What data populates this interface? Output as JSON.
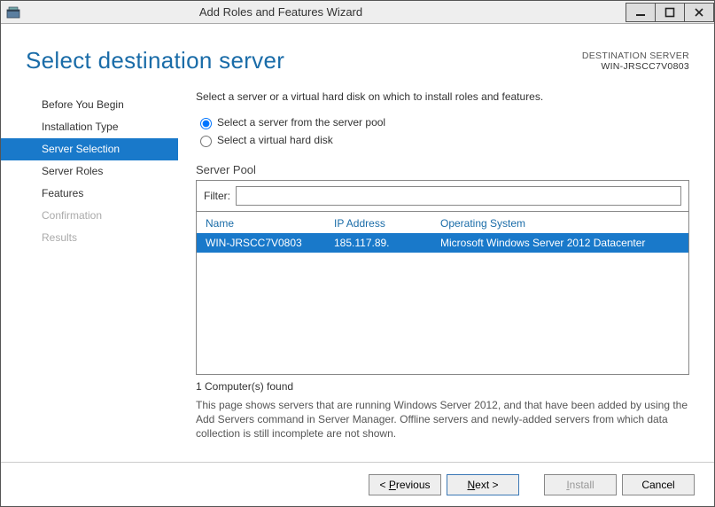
{
  "window": {
    "title": "Add Roles and Features Wizard"
  },
  "header": {
    "page_title": "Select destination server",
    "dest_label": "DESTINATION SERVER",
    "dest_server": "WIN-JRSCC7V0803"
  },
  "sidebar": {
    "items": [
      {
        "label": "Before You Begin",
        "state": "normal"
      },
      {
        "label": "Installation Type",
        "state": "normal"
      },
      {
        "label": "Server Selection",
        "state": "active"
      },
      {
        "label": "Server Roles",
        "state": "normal"
      },
      {
        "label": "Features",
        "state": "normal"
      },
      {
        "label": "Confirmation",
        "state": "disabled"
      },
      {
        "label": "Results",
        "state": "disabled"
      }
    ]
  },
  "main": {
    "instruction": "Select a server or a virtual hard disk on which to install roles and features.",
    "radio1": "Select a server from the server pool",
    "radio2": "Select a virtual hard disk",
    "pool_label": "Server Pool",
    "filter_label": "Filter:",
    "filter_value": "",
    "columns": {
      "name": "Name",
      "ip": "IP Address",
      "os": "Operating System"
    },
    "rows": [
      {
        "name": "WIN-JRSCC7V0803",
        "ip": "185.117.89.",
        "os": "Microsoft Windows Server 2012 Datacenter"
      }
    ],
    "found_text": "1 Computer(s) found",
    "help_text": "This page shows servers that are running Windows Server 2012, and that have been added by using the Add Servers command in Server Manager. Offline servers and newly-added servers from which data collection is still incomplete are not shown."
  },
  "footer": {
    "previous_pre": "< ",
    "previous_u": "P",
    "previous_post": "revious",
    "next_u": "N",
    "next_post": "ext >",
    "install_u": "I",
    "install_post": "nstall",
    "cancel": "Cancel"
  }
}
